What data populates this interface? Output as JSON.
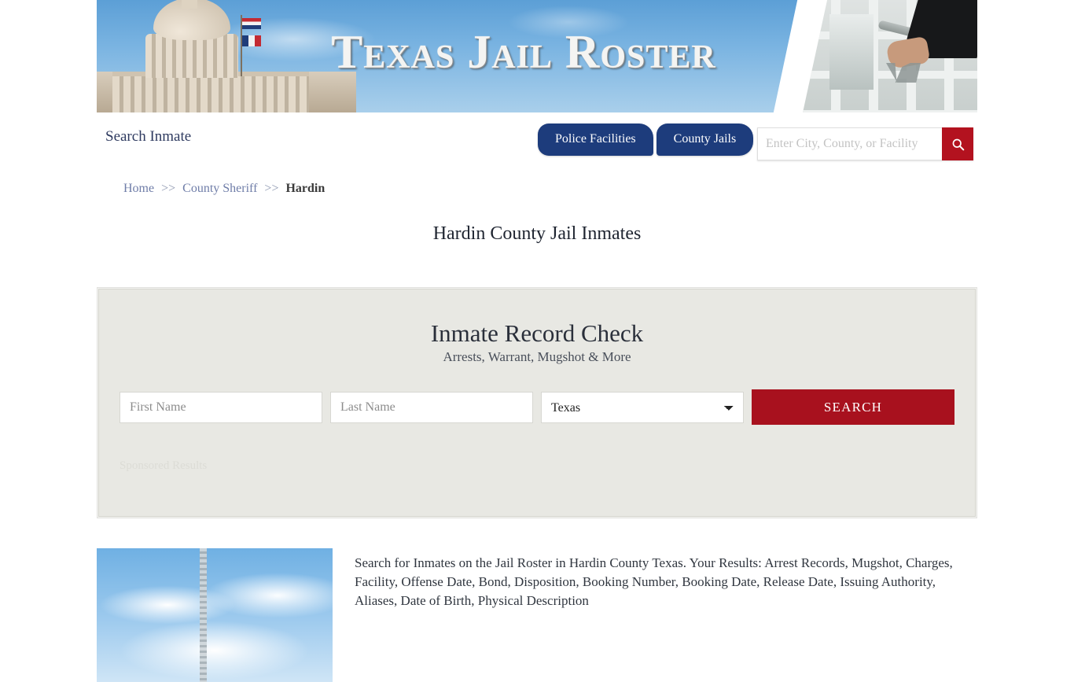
{
  "banner": {
    "title": "Texas Jail Roster",
    "left_image": "texas-state-capitol-photo",
    "right_image": "jail-door-keys-photo"
  },
  "nav": {
    "brand": "Search Inmate",
    "tabs": [
      {
        "label": "Police Facilities"
      },
      {
        "label": "County Jails"
      }
    ],
    "search": {
      "placeholder": "Enter City, County, or Facility",
      "value": "",
      "button_icon": "search-icon"
    }
  },
  "breadcrumb": {
    "items": [
      {
        "label": "Home",
        "type": "link"
      },
      {
        "label": "County Sheriff",
        "type": "link"
      },
      {
        "label": "Hardin",
        "type": "current"
      }
    ],
    "separator": ">>"
  },
  "page": {
    "title": "Hardin County Jail Inmates"
  },
  "record_check": {
    "heading": "Inmate Record Check",
    "subheading": "Arrests, Warrant, Mugshot & More",
    "first_name_placeholder": "First Name",
    "first_name_value": "",
    "last_name_placeholder": "Last Name",
    "last_name_value": "",
    "state_selected": "Texas",
    "state_options": [
      "Texas"
    ],
    "search_label": "SEARCH",
    "sponsored_label": "Sponsored Results"
  },
  "content": {
    "thumbnail_alt": "tower-against-blue-sky-photo",
    "paragraph": "Search for Inmates on the Jail Roster in Hardin County Texas. Your Results: Arrest Records, Mugshot, Charges, Facility, Offense Date, Bond, Disposition, Booking Number, Booking Date, Release Date, Issuing Authority, Aliases, Date of Birth, Physical Description"
  },
  "colors": {
    "navy": "#1d3c7c",
    "red": "#b3121f",
    "button_red": "#a8111e",
    "panel_bg": "#e8e8e3",
    "link": "#6f7da8"
  }
}
